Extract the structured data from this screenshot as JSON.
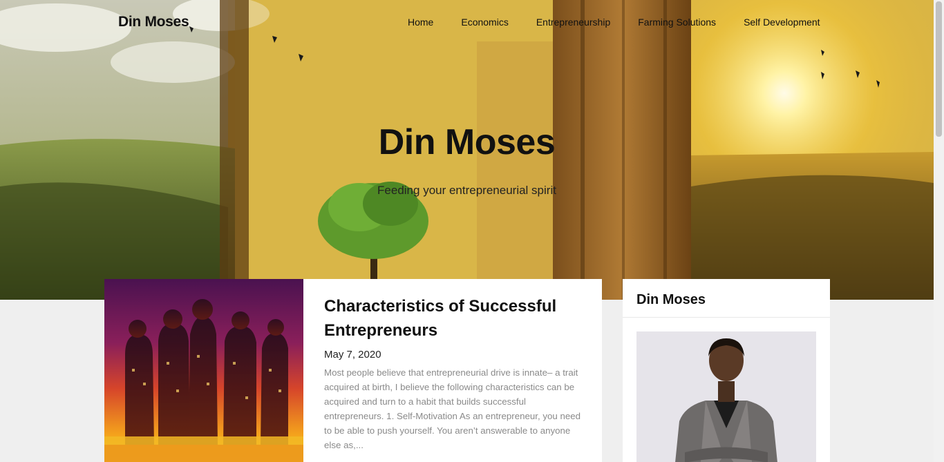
{
  "site": {
    "brand": "Din Moses",
    "nav": [
      "Home",
      "Economics",
      "Entrepreneurship",
      "Farming Solutions",
      "Self Development"
    ],
    "hero_title": "Din Moses",
    "hero_subtitle": "Feeding your entrepreneurial spirit"
  },
  "post": {
    "title": "Characteristics of Successful Entrepreneurs",
    "date": "May 7, 2020",
    "excerpt": "Most people believe that entrepreneurial drive is innate– a trait acquired at birth, I believe the following characteristics can be acquired and turn to a habit that builds successful entrepreneurs. 1. Self-Motivation As an entrepreneur, you need to be able to push yourself. You aren’t answerable to anyone else as,..."
  },
  "sidebar": {
    "widget_title": "Din Moses"
  },
  "colors": {
    "page_bg": "#efefef",
    "card_bg": "#ffffff",
    "excerpt_text": "#8a8a8a"
  }
}
